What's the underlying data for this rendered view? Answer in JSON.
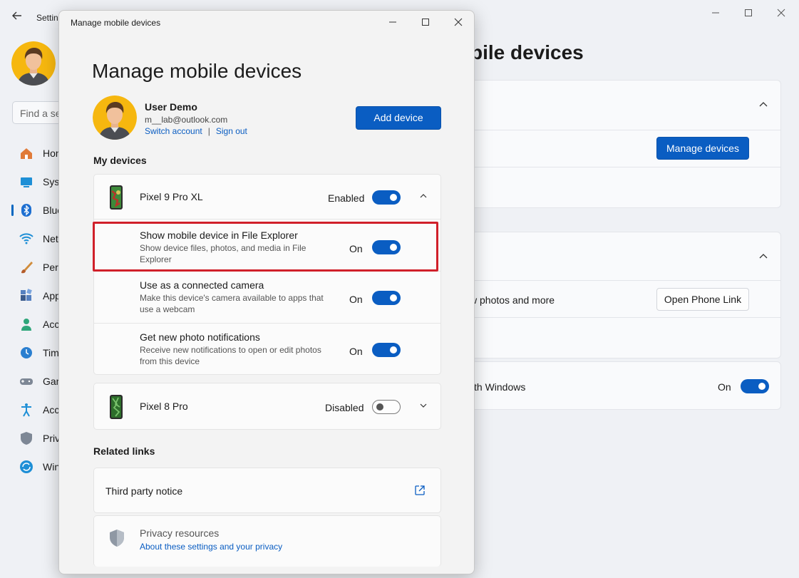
{
  "background": {
    "app_title": "Settin",
    "search_placeholder": "Find a se",
    "page_heading": "bile devices",
    "nav": [
      {
        "label": "Hon",
        "icon": "home-icon"
      },
      {
        "label": "Syst",
        "icon": "system-icon"
      },
      {
        "label": "Blue",
        "icon": "bluetooth-icon",
        "selected": true
      },
      {
        "label": "Net",
        "icon": "network-icon"
      },
      {
        "label": "Pers",
        "icon": "personalization-icon"
      },
      {
        "label": "App",
        "icon": "apps-icon"
      },
      {
        "label": "Acc",
        "icon": "accounts-icon"
      },
      {
        "label": "Tim",
        "icon": "time-icon"
      },
      {
        "label": "Gan",
        "icon": "gaming-icon"
      },
      {
        "label": "Acc",
        "icon": "accessibility-icon"
      },
      {
        "label": "Priv",
        "icon": "privacy-icon"
      },
      {
        "label": "Win",
        "icon": "update-icon"
      }
    ],
    "manage_devices_button": "Manage devices",
    "phone_link_text": "w photos and more",
    "open_phone_link_button": "Open Phone Link",
    "windows_row_text": "th Windows",
    "windows_row_state": "On"
  },
  "dialog": {
    "window_title": "Manage mobile devices",
    "heading": "Manage mobile devices",
    "user": {
      "name": "User Demo",
      "email": "m__lab@outlook.com",
      "switch_account": "Switch account",
      "separator": "|",
      "sign_out": "Sign out"
    },
    "add_device_button": "Add device",
    "my_devices_label": "My devices",
    "devices": [
      {
        "name": "Pixel 9 Pro XL",
        "state": "Enabled",
        "enabled": true,
        "expanded": true,
        "options": [
          {
            "title": "Show mobile device in File Explorer",
            "desc": "Show device files, photos, and media in File Explorer",
            "state": "On"
          },
          {
            "title": "Use as a connected camera",
            "desc": "Make this device's camera available to apps that use a webcam",
            "state": "On"
          },
          {
            "title": "Get new photo notifications",
            "desc": "Receive new notifications to open or edit photos from this device",
            "state": "On"
          }
        ]
      },
      {
        "name": "Pixel 8 Pro",
        "state": "Disabled",
        "enabled": false,
        "expanded": false
      }
    ],
    "related_links_label": "Related links",
    "third_party_notice": "Third party notice",
    "privacy_resources": "Privacy resources",
    "privacy_link": "About these settings and your privacy"
  },
  "colors": {
    "accent": "#0a5dc2",
    "highlight": "#d0202a"
  }
}
